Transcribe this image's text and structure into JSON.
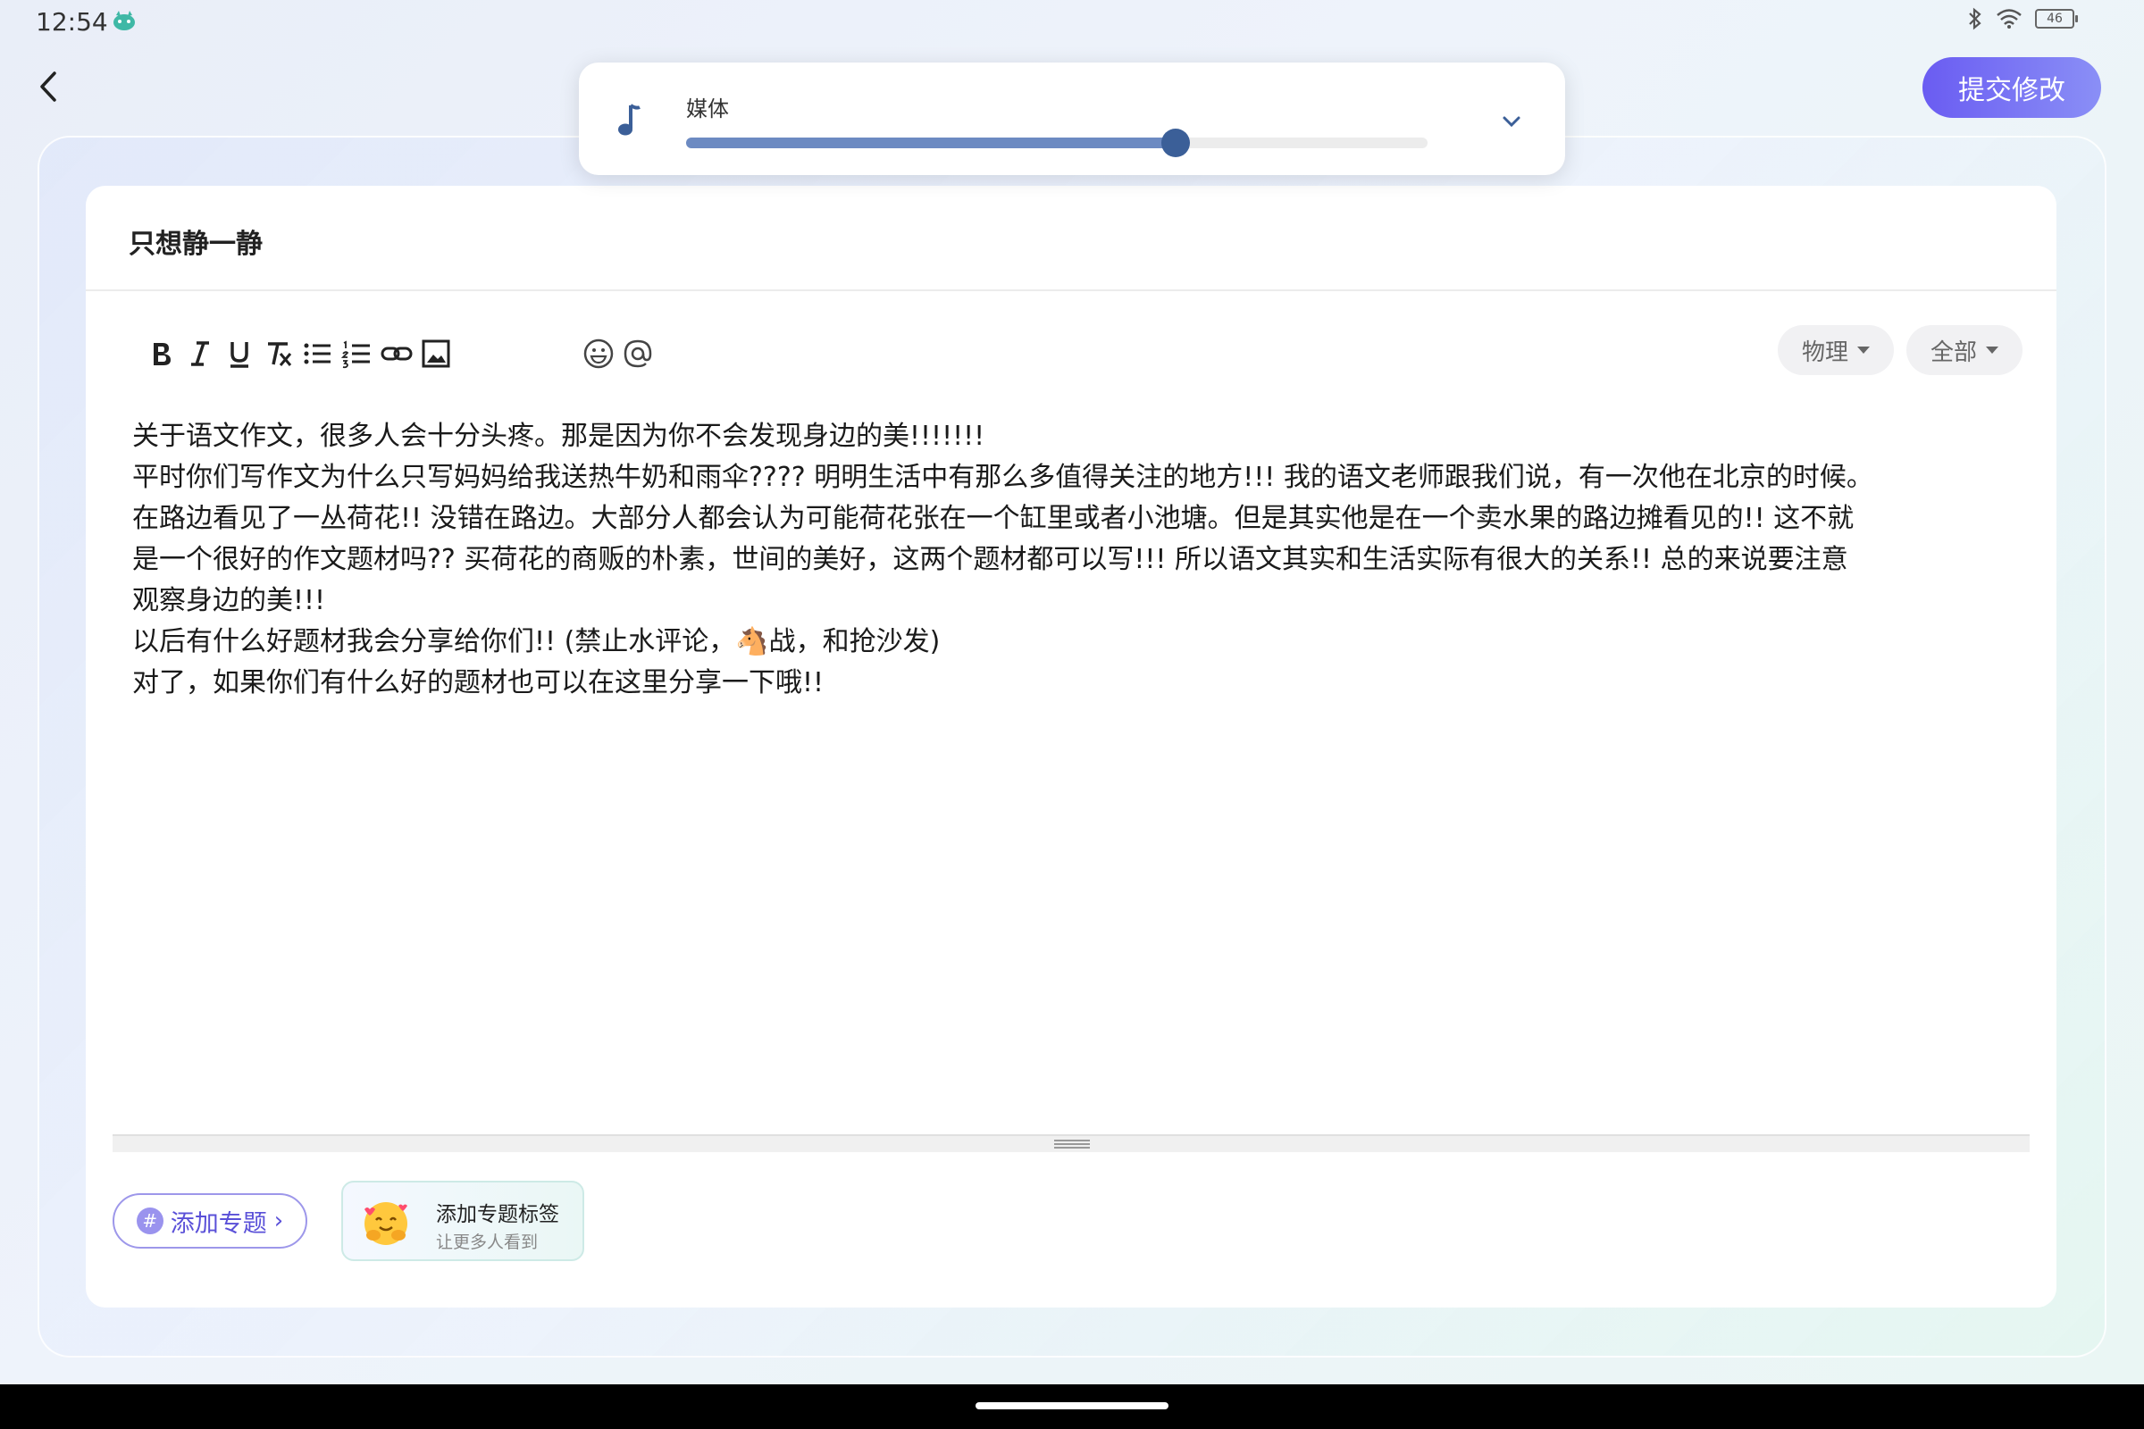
{
  "status_bar": {
    "time": "12:54",
    "battery": "46"
  },
  "header": {
    "submit_label": "提交修改"
  },
  "media_panel": {
    "label": "媒体",
    "volume_level": 0.66
  },
  "editor": {
    "title": "只想静一静",
    "toolbar": {
      "buttons": [
        "bold-icon",
        "italic-icon",
        "underline-icon",
        "clear-format-icon",
        "bullet-list-icon",
        "numbered-list-icon",
        "link-icon",
        "image-icon",
        "emoji-icon",
        "mention-icon"
      ]
    },
    "subject_select": "物理",
    "scope_select": "全部",
    "body_lines": [
      "关于语文作文，很多人会十分头疼。那是因为你不会发现身边的美!!!!!!!",
      "平时你们写作文为什么只写妈妈给我送热牛奶和雨伞????  明明生活中有那么多值得关注的地方!!!  我的语文老师跟我们说，有一次他在北京的时候。",
      "在路边看见了一丛荷花!!  没错在路边。大部分人都会认为可能荷花张在一个缸里或者小池塘。但是其实他是在一个卖水果的路边摊看见的!!  这不就",
      "是一个很好的作文题材吗??  买荷花的商贩的朴素，世间的美好，这两个题材都可以写!!!  所以语文其实和生活实际有很大的关系!!  总的来说要注意",
      "观察身边的美!!!",
      "以后有什么好题材我会分享给你们!!  (禁止水评论，",
      "对了，如果你们有什么好的题材也可以在这里分享一下哦!!"
    ],
    "line6_after_emoji": "战，和抢沙发)",
    "line6_emoji": "🐴"
  },
  "footer": {
    "add_topic_label": "添加专题",
    "hint_title": "添加专题标签",
    "hint_subtitle": "让更多人看到"
  },
  "colors": {
    "accent": "#6a5cf2",
    "slider": "#3b5f98"
  }
}
